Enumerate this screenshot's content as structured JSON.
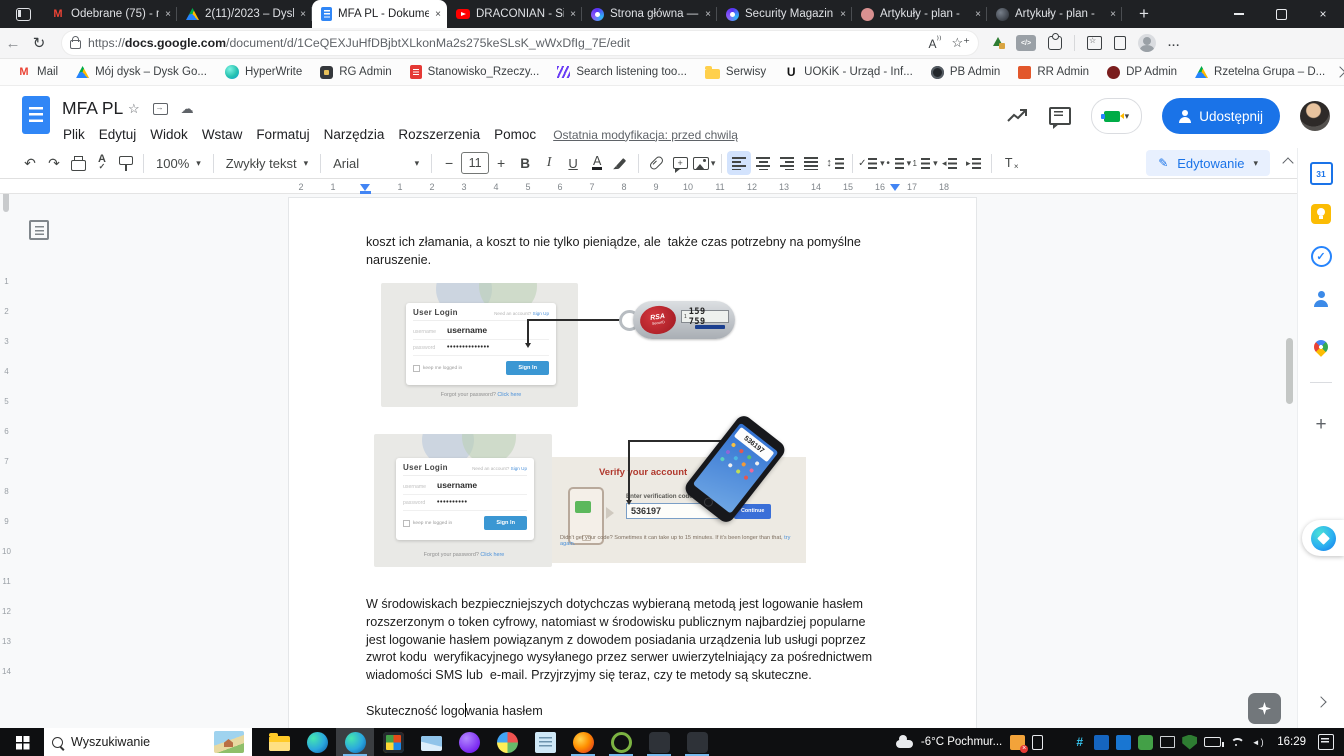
{
  "browser": {
    "tabs": [
      {
        "icon": "gmailico",
        "label": "Odebrane (75) - n",
        "state": "inactive"
      },
      {
        "icon": "driveico",
        "label": "2(11)/2023 – Dysk",
        "state": "inactive"
      },
      {
        "icon": "docsico",
        "label": "MFA PL - Dokume",
        "state": "active"
      },
      {
        "icon": "ytico",
        "label": "DRACONIAN - Sie",
        "state": "inactive"
      },
      {
        "icon": "aureole",
        "label": "Strona główna —",
        "state": "inactive"
      },
      {
        "icon": "aureole",
        "label": "Security Magazin",
        "state": "inactive"
      },
      {
        "icon": "roseico",
        "label": "Artykuły - plan -",
        "state": "inactive"
      },
      {
        "icon": "darkglobe",
        "label": "Artykuły - plan -",
        "state": "inactive"
      }
    ],
    "address": {
      "scheme": "https://",
      "host": "docs.google.com",
      "path": "/document/d/1CeQEXJuHfDBjbtXLkonMa2s275keSLsK_wWxDfIg_7E/edit"
    },
    "bookmarks": [
      {
        "icon": "gmailico",
        "label": "Mail"
      },
      {
        "icon": "driveico",
        "label": "Mój dysk – Dysk Go..."
      },
      {
        "icon": "hyperico",
        "label": "HyperWrite"
      },
      {
        "icon": "rgico",
        "label": "RG Admin"
      },
      {
        "icon": "pdfico",
        "label": "Stanowisko_Rzeczy..."
      },
      {
        "icon": "waveico",
        "label": "Search listening too..."
      },
      {
        "icon": "folderico",
        "label": "Serwisy"
      },
      {
        "icon": "uico",
        "label": "UOKiK - Urząd - Inf..."
      },
      {
        "icon": "pbico",
        "label": "PB Admin"
      },
      {
        "icon": "rrico",
        "label": "RR Admin"
      },
      {
        "icon": "dpico",
        "label": "DP Admin"
      },
      {
        "icon": "driveico",
        "label": "Rzetelna Grupa – D..."
      }
    ]
  },
  "docs": {
    "title": "MFA PL",
    "menus": [
      {
        "label": "Plik"
      },
      {
        "label": "Edytuj"
      },
      {
        "label": "Widok"
      },
      {
        "label": "Wstaw"
      },
      {
        "label": "Formatuj"
      },
      {
        "label": "Narzędzia"
      },
      {
        "label": "Rozszerzenia"
      },
      {
        "label": "Pomoc"
      }
    ],
    "last_modified": "Ostatnia modyfikacja: przed chwilą",
    "share_label": "Udostępnij",
    "mode_label": "Edytowanie",
    "zoom_value": "100%",
    "style_value": "Zwykły tekst",
    "font_value": "Arial",
    "font_size": "11",
    "accent_color": "#1a73e8"
  },
  "ruler": {
    "left_numbers": [
      "2",
      "1"
    ],
    "numbers": [
      "1",
      "2",
      "3",
      "4",
      "5",
      "6",
      "7",
      "8",
      "9",
      "10",
      "11",
      "12",
      "13",
      "14",
      "15",
      "16",
      "17",
      "18"
    ],
    "v_numbers": [
      "1",
      "2",
      "3",
      "4",
      "5",
      "6",
      "7",
      "8",
      "9",
      "10",
      "11",
      "12",
      "13",
      "14"
    ]
  },
  "document": {
    "para1": "koszt ich złamania, a koszt to nie tylko pieniądze, ale  także czas potrzebny na pomyślne naruszenie.",
    "para2": "W środowiskach bezpieczniejszych dotychczas wybieraną metodą jest logowanie hasłem rozszerzonym o token cyfrowy, natomiast w środowisku publicznym najbardziej popularne jest logowanie hasłem powiązanym z dowodem posiadania urządzenia lub usługi poprzez zwrot kodu  weryfikacyjnego wysyłanego przez serwer uwierzytelniający za pośrednictwem wiadomości SMS lub  e-mail. Przyjrzyjmy się teraz, czy te metody są skuteczne.",
    "para3_before": "Skuteczność logo",
    "para3_after": "wania hasłem",
    "fig_token": {
      "login": {
        "heading": "User Login",
        "signup_text": "Need an account?",
        "signup_link": "Sign Up",
        "username_label": "username",
        "username_value": "username",
        "password_label": "password",
        "password_value": "••••••••••••••",
        "keep_label": "keep me logged in",
        "signin_label": "Sign In",
        "forgot_text": "Forgot your password?",
        "forgot_link": "Click here"
      },
      "token_brand": "RSA",
      "token_brand2": "SecurID",
      "token_digit": "1",
      "token_display": "159 759"
    },
    "fig_sms": {
      "login": {
        "heading": "User Login",
        "signup_text": "Need an account?",
        "signup_link": "Sign Up",
        "username_label": "username",
        "username_value": "username",
        "password_label": "password",
        "password_value": "••••••••••",
        "keep_label": "keep me logged in",
        "signin_label": "Sign In",
        "forgot_text": "Forgot your password?",
        "forgot_link": "Click here"
      },
      "verify_heading": "Verify your account",
      "code_label": "Enter verification code",
      "code_value": "536197",
      "continue_label": "Continue",
      "note_text": "Didn't get your code? Sometimes it can take up to 15 minutes. If it's been longer than that, ",
      "note_link": "try again.",
      "phone_code": "536197"
    }
  },
  "taskbar": {
    "search_placeholder": "Wyszukiwanie",
    "weather": "-6°C  Pochmur...",
    "time": "16:29",
    "apps": [
      {
        "icon": "explorer",
        "state": "normal"
      },
      {
        "icon": "edge",
        "state": "normal"
      },
      {
        "icon": "edge",
        "state": "active"
      },
      {
        "icon": "officegrid",
        "state": "normal"
      },
      {
        "icon": "mail",
        "state": "normal"
      },
      {
        "icon": "purple",
        "state": "normal"
      },
      {
        "icon": "pie",
        "state": "normal"
      },
      {
        "icon": "notepad",
        "state": "normal"
      },
      {
        "icon": "firefox",
        "state": "running"
      },
      {
        "icon": "greenring",
        "state": "running"
      },
      {
        "icon": "darkapp",
        "state": "running"
      },
      {
        "icon": "darkapp",
        "state": "running"
      }
    ],
    "tray": [
      {
        "icon": "alert-orange"
      },
      {
        "icon": "phone-ico"
      },
      {
        "icon": "red-x"
      },
      {
        "icon": "slack"
      },
      {
        "icon": "blue-app"
      },
      {
        "icon": "w-blue"
      },
      {
        "icon": "chat-green"
      },
      {
        "icon": "cast"
      },
      {
        "icon": "shield-green"
      },
      {
        "icon": "battery"
      },
      {
        "icon": "wifi"
      },
      {
        "icon": "volume"
      }
    ]
  }
}
